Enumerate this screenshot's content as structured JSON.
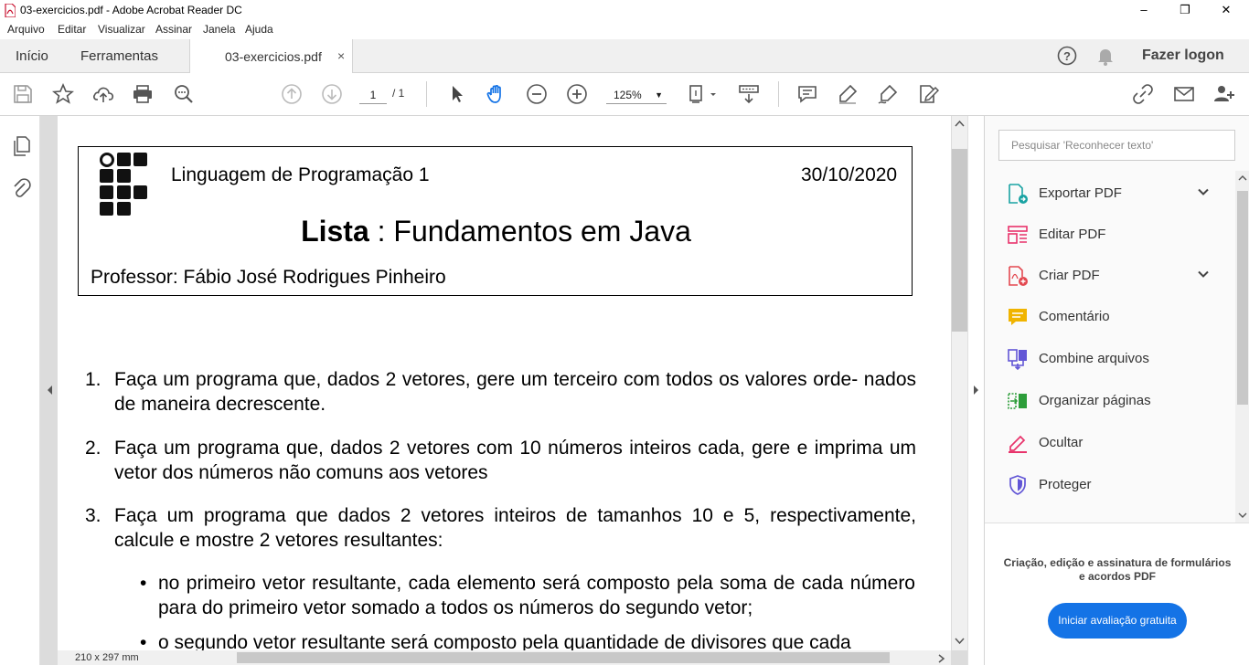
{
  "window": {
    "title": "03-exercicios.pdf - Adobe Acrobat Reader DC",
    "minimize": "–",
    "maximize": "❐",
    "close": "✕"
  },
  "menu": [
    "Arquivo",
    "Editar",
    "Visualizar",
    "Assinar",
    "Janela",
    "Ajuda"
  ],
  "tabs": {
    "home": "Início",
    "tools": "Ferramentas",
    "document": "03-exercicios.pdf",
    "close": "×",
    "login": "Fazer logon"
  },
  "toolbar": {
    "page_current": "1",
    "page_total": "/ 1",
    "zoom": "125%"
  },
  "document": {
    "course": "Linguagem de Programação 1",
    "date": "30/10/2020",
    "title_bold": "Lista",
    "title_rest": " : Fundamentos em Java",
    "professor": "Professor: Fábio José Rodrigues Pinheiro",
    "items": [
      {
        "num": "1.",
        "text": "Faça um programa que, dados 2 vetores, gere um terceiro com todos os valores orde- nados de maneira decrescente."
      },
      {
        "num": "2.",
        "text": "Faça um programa que, dados 2 vetores com 10 números inteiros cada, gere e imprima um vetor dos números não comuns aos vetores"
      },
      {
        "num": "3.",
        "text": "Faça um programa que dados 2 vetores inteiros de tamanhos 10 e 5, respectivamente, calcule e mostre 2 vetores resultantes:"
      }
    ],
    "bullets": [
      {
        "dot": "•",
        "text": "no primeiro vetor resultante, cada elemento será composto pela soma de cada número para do primeiro vetor somado a todos os números do segundo vetor;"
      },
      {
        "dot": "•",
        "text": "o segundo vetor resultante será composto pela quantidade de divisores que cada"
      }
    ],
    "page_size": "210 x 297 mm"
  },
  "right_panel": {
    "search_placeholder": "Pesquisar 'Reconhecer texto'",
    "tools": [
      {
        "label": "Exportar PDF",
        "icon": "export-pdf-icon",
        "color": "#1aa3a3"
      },
      {
        "label": "Editar PDF",
        "icon": "edit-pdf-icon",
        "color": "#e8336b"
      },
      {
        "label": "Criar PDF",
        "icon": "create-pdf-icon",
        "color": "#e34850"
      },
      {
        "label": "Comentário",
        "icon": "comment-icon",
        "color": "#f0b400"
      },
      {
        "label": "Combine arquivos",
        "icon": "combine-files-icon",
        "color": "#6256d6"
      },
      {
        "label": "Organizar páginas",
        "icon": "organize-pages-icon",
        "color": "#2d9d3a"
      },
      {
        "label": "Ocultar",
        "icon": "redact-icon",
        "color": "#e8336b"
      },
      {
        "label": "Proteger",
        "icon": "protect-icon",
        "color": "#6256d6"
      }
    ],
    "promo_text": "Criação, edição e assinatura de formulários e acordos PDF",
    "trial_button": "Iniciar avaliação gratuita"
  },
  "colors": {
    "accent": "#1473e6",
    "hand_tool": "#1473e6"
  }
}
